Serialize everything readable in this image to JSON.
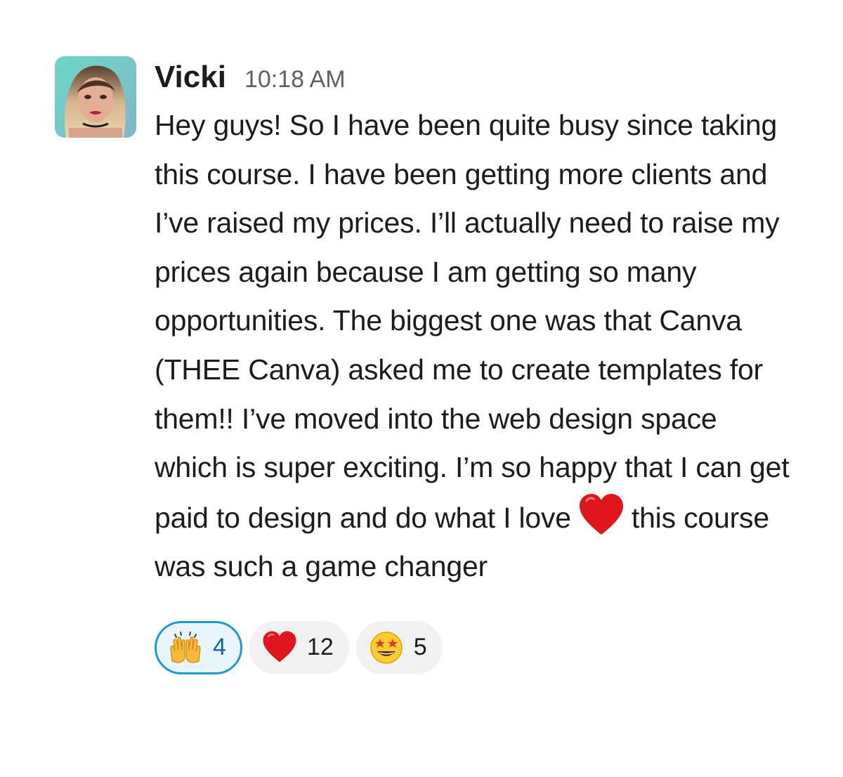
{
  "message": {
    "author": "Vicki",
    "timestamp": "10:18 AM",
    "text_before_emoji": "Hey guys! So I have been quite busy since taking this course. I have been getting more clients and I’ve raised my prices. I’ll actually need to raise my prices again because I am getting so many opportunities. The biggest one was that Canva (THEE Canva) asked me to create templates for them!! I’ve moved into the web design space which is super exciting. I’m so happy that I can get paid to design and do what I love",
    "inline_emoji": "red-heart-icon",
    "text_after_emoji": "this course was such a game changer"
  },
  "reactions": [
    {
      "emoji": "raising-hands-icon",
      "count": "4",
      "selected": true
    },
    {
      "emoji": "red-heart-icon",
      "count": "12",
      "selected": false
    },
    {
      "emoji": "star-struck-icon",
      "count": "5",
      "selected": false
    }
  ],
  "colors": {
    "selected_border": "#1d9bd1",
    "selected_bg": "#e8f5fa",
    "pill_bg": "#f2f1f2",
    "timestamp": "#616061"
  }
}
